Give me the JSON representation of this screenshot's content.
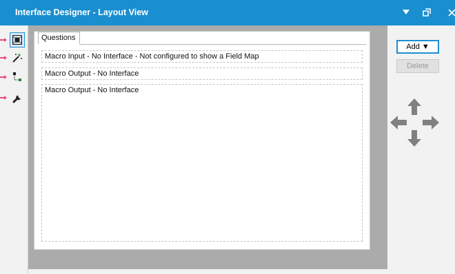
{
  "window": {
    "title": "Interface Designer - Layout View",
    "dropdown_icon": "caret-down-icon",
    "restore_icon": "restore-window-icon",
    "close_icon": "close-icon"
  },
  "toolbar": {
    "tools": [
      {
        "name": "layout-view-tool",
        "icon": "layout-view-icon",
        "active": true
      },
      {
        "name": "actions-tool",
        "icon": "magic-wand-icon",
        "active": false
      },
      {
        "name": "tree-tool",
        "icon": "tree-hierarchy-icon",
        "active": false
      },
      {
        "name": "properties-tool",
        "icon": "wrench-icon",
        "active": false
      }
    ]
  },
  "layout": {
    "tab_label": "Questions",
    "items": [
      {
        "label": "Macro Input - No Interface - Not configured to show a Field Map"
      },
      {
        "label": "Macro Output - No Interface"
      },
      {
        "label": "Macro Output - No Interface"
      }
    ]
  },
  "actions": {
    "add_label": "Add ▼",
    "delete_label": "Delete"
  },
  "colors": {
    "titlebar": "#1a8fd0",
    "canvas": "#ababab",
    "marker": "#e2507a",
    "arrows": "#808080"
  }
}
